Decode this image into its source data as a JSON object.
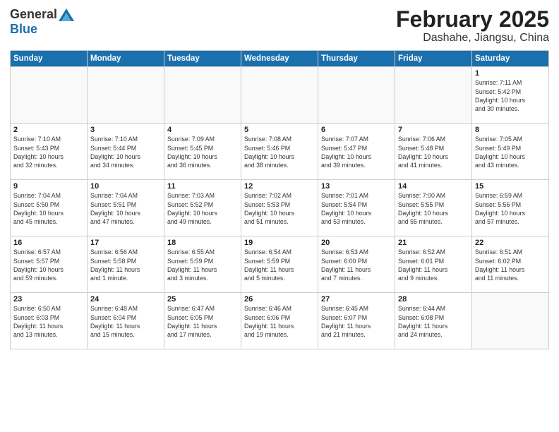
{
  "header": {
    "logo_general": "General",
    "logo_blue": "Blue",
    "month_title": "February 2025",
    "location": "Dashahe, Jiangsu, China"
  },
  "days_of_week": [
    "Sunday",
    "Monday",
    "Tuesday",
    "Wednesday",
    "Thursday",
    "Friday",
    "Saturday"
  ],
  "weeks": [
    [
      {
        "day": "",
        "info": ""
      },
      {
        "day": "",
        "info": ""
      },
      {
        "day": "",
        "info": ""
      },
      {
        "day": "",
        "info": ""
      },
      {
        "day": "",
        "info": ""
      },
      {
        "day": "",
        "info": ""
      },
      {
        "day": "1",
        "info": "Sunrise: 7:11 AM\nSunset: 5:42 PM\nDaylight: 10 hours\nand 30 minutes."
      }
    ],
    [
      {
        "day": "2",
        "info": "Sunrise: 7:10 AM\nSunset: 5:43 PM\nDaylight: 10 hours\nand 32 minutes."
      },
      {
        "day": "3",
        "info": "Sunrise: 7:10 AM\nSunset: 5:44 PM\nDaylight: 10 hours\nand 34 minutes."
      },
      {
        "day": "4",
        "info": "Sunrise: 7:09 AM\nSunset: 5:45 PM\nDaylight: 10 hours\nand 36 minutes."
      },
      {
        "day": "5",
        "info": "Sunrise: 7:08 AM\nSunset: 5:46 PM\nDaylight: 10 hours\nand 38 minutes."
      },
      {
        "day": "6",
        "info": "Sunrise: 7:07 AM\nSunset: 5:47 PM\nDaylight: 10 hours\nand 39 minutes."
      },
      {
        "day": "7",
        "info": "Sunrise: 7:06 AM\nSunset: 5:48 PM\nDaylight: 10 hours\nand 41 minutes."
      },
      {
        "day": "8",
        "info": "Sunrise: 7:05 AM\nSunset: 5:49 PM\nDaylight: 10 hours\nand 43 minutes."
      }
    ],
    [
      {
        "day": "9",
        "info": "Sunrise: 7:04 AM\nSunset: 5:50 PM\nDaylight: 10 hours\nand 45 minutes."
      },
      {
        "day": "10",
        "info": "Sunrise: 7:04 AM\nSunset: 5:51 PM\nDaylight: 10 hours\nand 47 minutes."
      },
      {
        "day": "11",
        "info": "Sunrise: 7:03 AM\nSunset: 5:52 PM\nDaylight: 10 hours\nand 49 minutes."
      },
      {
        "day": "12",
        "info": "Sunrise: 7:02 AM\nSunset: 5:53 PM\nDaylight: 10 hours\nand 51 minutes."
      },
      {
        "day": "13",
        "info": "Sunrise: 7:01 AM\nSunset: 5:54 PM\nDaylight: 10 hours\nand 53 minutes."
      },
      {
        "day": "14",
        "info": "Sunrise: 7:00 AM\nSunset: 5:55 PM\nDaylight: 10 hours\nand 55 minutes."
      },
      {
        "day": "15",
        "info": "Sunrise: 6:59 AM\nSunset: 5:56 PM\nDaylight: 10 hours\nand 57 minutes."
      }
    ],
    [
      {
        "day": "16",
        "info": "Sunrise: 6:57 AM\nSunset: 5:57 PM\nDaylight: 10 hours\nand 59 minutes."
      },
      {
        "day": "17",
        "info": "Sunrise: 6:56 AM\nSunset: 5:58 PM\nDaylight: 11 hours\nand 1 minute."
      },
      {
        "day": "18",
        "info": "Sunrise: 6:55 AM\nSunset: 5:59 PM\nDaylight: 11 hours\nand 3 minutes."
      },
      {
        "day": "19",
        "info": "Sunrise: 6:54 AM\nSunset: 5:59 PM\nDaylight: 11 hours\nand 5 minutes."
      },
      {
        "day": "20",
        "info": "Sunrise: 6:53 AM\nSunset: 6:00 PM\nDaylight: 11 hours\nand 7 minutes."
      },
      {
        "day": "21",
        "info": "Sunrise: 6:52 AM\nSunset: 6:01 PM\nDaylight: 11 hours\nand 9 minutes."
      },
      {
        "day": "22",
        "info": "Sunrise: 6:51 AM\nSunset: 6:02 PM\nDaylight: 11 hours\nand 11 minutes."
      }
    ],
    [
      {
        "day": "23",
        "info": "Sunrise: 6:50 AM\nSunset: 6:03 PM\nDaylight: 11 hours\nand 13 minutes."
      },
      {
        "day": "24",
        "info": "Sunrise: 6:48 AM\nSunset: 6:04 PM\nDaylight: 11 hours\nand 15 minutes."
      },
      {
        "day": "25",
        "info": "Sunrise: 6:47 AM\nSunset: 6:05 PM\nDaylight: 11 hours\nand 17 minutes."
      },
      {
        "day": "26",
        "info": "Sunrise: 6:46 AM\nSunset: 6:06 PM\nDaylight: 11 hours\nand 19 minutes."
      },
      {
        "day": "27",
        "info": "Sunrise: 6:45 AM\nSunset: 6:07 PM\nDaylight: 11 hours\nand 21 minutes."
      },
      {
        "day": "28",
        "info": "Sunrise: 6:44 AM\nSunset: 6:08 PM\nDaylight: 11 hours\nand 24 minutes."
      },
      {
        "day": "",
        "info": ""
      }
    ]
  ]
}
